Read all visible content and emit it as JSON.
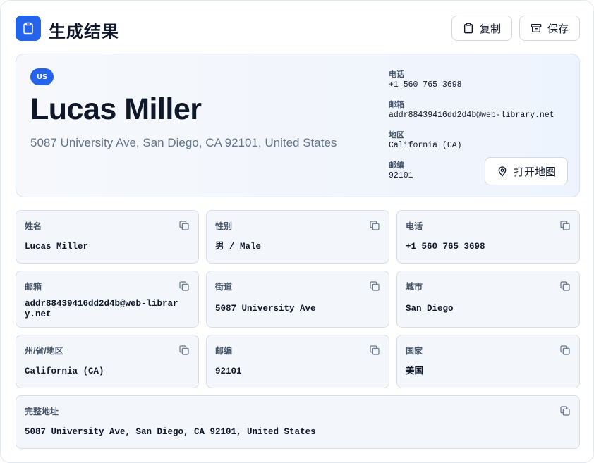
{
  "header": {
    "title": "生成结果",
    "copy_label": "复制",
    "save_label": "保存"
  },
  "hero": {
    "badge": "US",
    "name": "Lucas Miller",
    "address": "5087 University Ave, San Diego, CA 92101, United States",
    "info": [
      {
        "label": "电话",
        "value": "+1 560 765 3698"
      },
      {
        "label": "邮箱",
        "value": "addr88439416dd2d4b@web-library.net"
      },
      {
        "label": "地区",
        "value": "California (CA)"
      },
      {
        "label": "邮编",
        "value": "92101"
      }
    ],
    "map_label": "打开地图"
  },
  "fields": [
    {
      "label": "姓名",
      "value": "Lucas Miller"
    },
    {
      "label": "性别",
      "value": "男 / Male"
    },
    {
      "label": "电话",
      "value": "+1 560 765 3698"
    },
    {
      "label": "邮箱",
      "value": "addr88439416dd2d4b@web-library.net"
    },
    {
      "label": "街道",
      "value": "5087 University Ave"
    },
    {
      "label": "城市",
      "value": "San Diego"
    },
    {
      "label": "州/省/地区",
      "value": "California (CA)"
    },
    {
      "label": "邮编",
      "value": "92101"
    },
    {
      "label": "国家",
      "value": "美国"
    },
    {
      "label": "完整地址",
      "value": "5087 University Ave, San Diego, CA 92101, United States"
    }
  ],
  "colors": {
    "accent": "#2563eb",
    "card_bg": "#f3f6fa",
    "text": "#0f172a",
    "muted": "#64748b"
  },
  "icons": {
    "logo": "clipboard-icon",
    "copy": "clipboard-icon",
    "save": "archive-icon",
    "map": "map-pin-icon",
    "field_copy": "copy-icon"
  }
}
